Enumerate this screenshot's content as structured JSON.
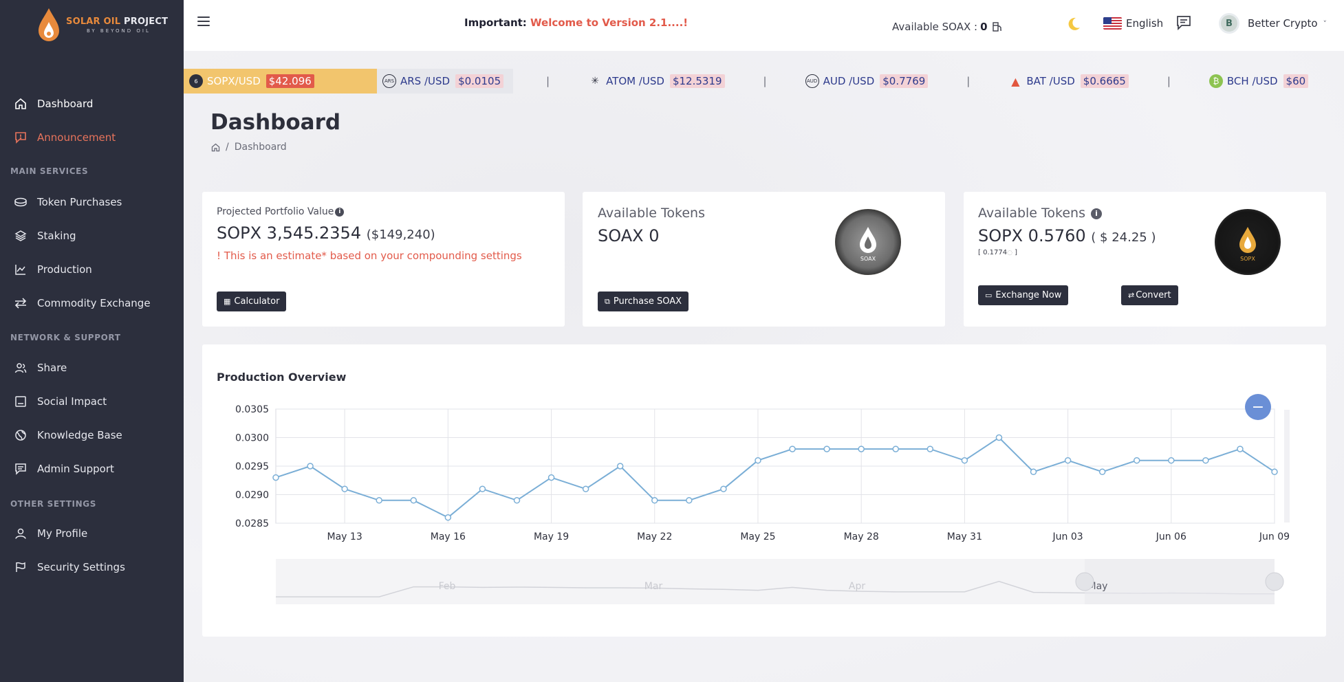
{
  "brand": {
    "name_part1": "SOLAR OIL",
    "name_part2": "PROJECT",
    "tagline": "BY BEYOND OIL"
  },
  "sidebar": {
    "items": [
      {
        "label": "Dashboard",
        "icon": "home-icon",
        "state": "active"
      },
      {
        "label": "Announcement",
        "icon": "announcement-icon",
        "state": "alert"
      },
      {
        "label": "Token Purchases",
        "icon": "token-purchases-icon"
      },
      {
        "label": "Staking",
        "icon": "staking-icon"
      },
      {
        "label": "Production",
        "icon": "production-chart-icon"
      },
      {
        "label": "Commodity Exchange",
        "icon": "exchange-arrows-icon"
      },
      {
        "label": "Share",
        "icon": "share-users-icon"
      },
      {
        "label": "Social Impact",
        "icon": "social-impact-icon"
      },
      {
        "label": "Knowledge Base",
        "icon": "globe-icon"
      },
      {
        "label": "Admin Support",
        "icon": "support-chat-icon"
      },
      {
        "label": "My Profile",
        "icon": "profile-icon"
      },
      {
        "label": "Security Settings",
        "icon": "security-icon"
      }
    ],
    "sections": [
      "MAIN SERVICES",
      "NETWORK & SUPPORT",
      "OTHER SETTINGS"
    ]
  },
  "header": {
    "announce_label": "Important:",
    "announce_text": "Welcome to Version 2.1....!",
    "available_soax_label": "Available SOAX :",
    "available_soax_value": "0",
    "language": "English",
    "user_initial": "B",
    "user_name": "Better Crypto",
    "user_caret": "˅"
  },
  "ticker": [
    {
      "pair": "SOPX/USD",
      "price": "$42.096",
      "icon_text": "6"
    },
    {
      "pair": "ARS /USD",
      "price": "$0.0105",
      "icon_text": "ARS"
    },
    {
      "pair": "ATOM /USD",
      "price": "$12.5319",
      "icon_text": "✳"
    },
    {
      "pair": "AUD /USD",
      "price": "$0.7769",
      "icon_text": "AUD"
    },
    {
      "pair": "BAT /USD",
      "price": "$0.6665",
      "icon_text": "▲"
    },
    {
      "pair": "BCH /USD",
      "price": "$60",
      "icon_text": "₿"
    }
  ],
  "ticker_separator": "|",
  "page": {
    "title": "Dashboard",
    "breadcrumb_separator": "/",
    "breadcrumb": "Dashboard"
  },
  "portfolio": {
    "label": "Projected Portfolio Value",
    "value": "SOPX 3,545.2354",
    "usd": "($149,240)",
    "warning": "! This is an estimate* based on your compounding settings",
    "button": "Calculator"
  },
  "soax_card": {
    "title": "Available Tokens",
    "value": "SOAX 0",
    "button": "Purchase SOAX",
    "coin_label": "SOAX"
  },
  "sopx_card": {
    "title": "Available Tokens",
    "value": "SOPX 0.5760",
    "usd": "( $ 24.25 )",
    "sub_open": "[ 0.1774",
    "sub_close": " ]",
    "button_exchange": "Exchange Now",
    "button_convert": "Convert",
    "coin_label": "SOPX"
  },
  "production": {
    "title": "Production Overview",
    "navigator_labels": [
      "Feb",
      "Mar",
      "Apr",
      "May"
    ]
  },
  "colors": {
    "sidebar_bg": "#2c2f3d",
    "accent_red": "#e25a4a",
    "ticker_gold": "#f2c56d",
    "line": "#7aaed6"
  },
  "chart_data": {
    "type": "line",
    "title": "Production Overview",
    "x": [
      "May 11",
      "May 12",
      "May 13",
      "May 14",
      "May 15",
      "May 16",
      "May 17",
      "May 18",
      "May 19",
      "May 20",
      "May 21",
      "May 22",
      "May 23",
      "May 24",
      "May 25",
      "May 26",
      "May 27",
      "May 28",
      "May 29",
      "May 30",
      "May 31",
      "Jun 01",
      "Jun 02",
      "Jun 03",
      "Jun 04",
      "Jun 05",
      "Jun 06",
      "Jun 07",
      "Jun 08",
      "Jun 09"
    ],
    "values": [
      0.0293,
      0.0295,
      0.0291,
      0.0289,
      0.0289,
      0.0286,
      0.0291,
      0.0289,
      0.0293,
      0.0291,
      0.0295,
      0.0289,
      0.0289,
      0.0291,
      0.0296,
      0.0298,
      0.0298,
      0.0298,
      0.0298,
      0.0298,
      0.0296,
      0.03,
      0.0294,
      0.0296,
      0.0294,
      0.0296,
      0.0296,
      0.0296,
      0.0298,
      0.0294
    ],
    "x_ticks": [
      "May 13",
      "May 16",
      "May 19",
      "May 22",
      "May 25",
      "May 28",
      "May 31",
      "Jun 03",
      "Jun 06",
      "Jun 09"
    ],
    "y_ticks": [
      "0.0285",
      "0.0290",
      "0.0295",
      "0.0300",
      "0.0305"
    ],
    "ylim": [
      0.0285,
      0.0305
    ],
    "grid": true
  }
}
